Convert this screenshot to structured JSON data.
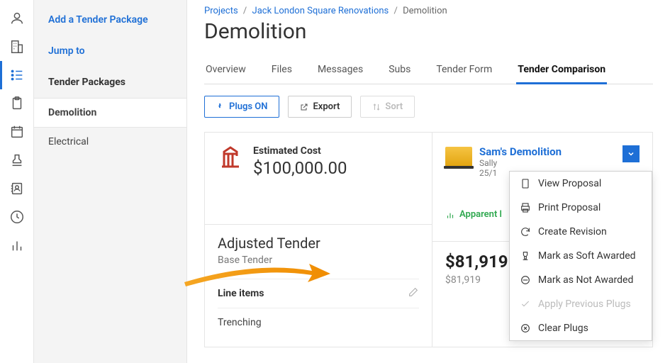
{
  "sidebar": {
    "add_link": "Add a Tender Package",
    "jump_link": "Jump to",
    "section_label": "Tender Packages",
    "items": [
      {
        "label": "Demolition",
        "active": true
      },
      {
        "label": "Electrical",
        "active": false
      }
    ]
  },
  "breadcrumbs": {
    "parts": [
      "Projects",
      "Jack London Square Renovations",
      "Demolition"
    ]
  },
  "page_title": "Demolition",
  "tabs": [
    {
      "label": "Overview"
    },
    {
      "label": "Files"
    },
    {
      "label": "Messages"
    },
    {
      "label": "Subs"
    },
    {
      "label": "Tender Form"
    },
    {
      "label": "Tender Comparison",
      "active": true
    }
  ],
  "toolbar": {
    "plugs_label": "Plugs ON",
    "export_label": "Export",
    "sort_label": "Sort"
  },
  "estimate": {
    "label": "Estimated Cost",
    "amount": "$100,000.00"
  },
  "bidder": {
    "name": "Sam's Demolition",
    "contact": "Sally",
    "date": "25/1",
    "apparent_label": "Apparent l",
    "adjusted_amount": "$81,919",
    "base_amount": "$81,919"
  },
  "tender_section": {
    "adjusted_label": "Adjusted Tender",
    "base_label": "Base Tender",
    "line_items_label": "Line items",
    "line_items": [
      "Trenching"
    ]
  },
  "menu": {
    "view": "View Proposal",
    "print": "Print Proposal",
    "revision": "Create Revision",
    "soft_award": "Mark as Soft Awarded",
    "not_award": "Mark as Not Awarded",
    "apply_plugs": "Apply Previous Plugs",
    "clear_plugs": "Clear Plugs"
  }
}
